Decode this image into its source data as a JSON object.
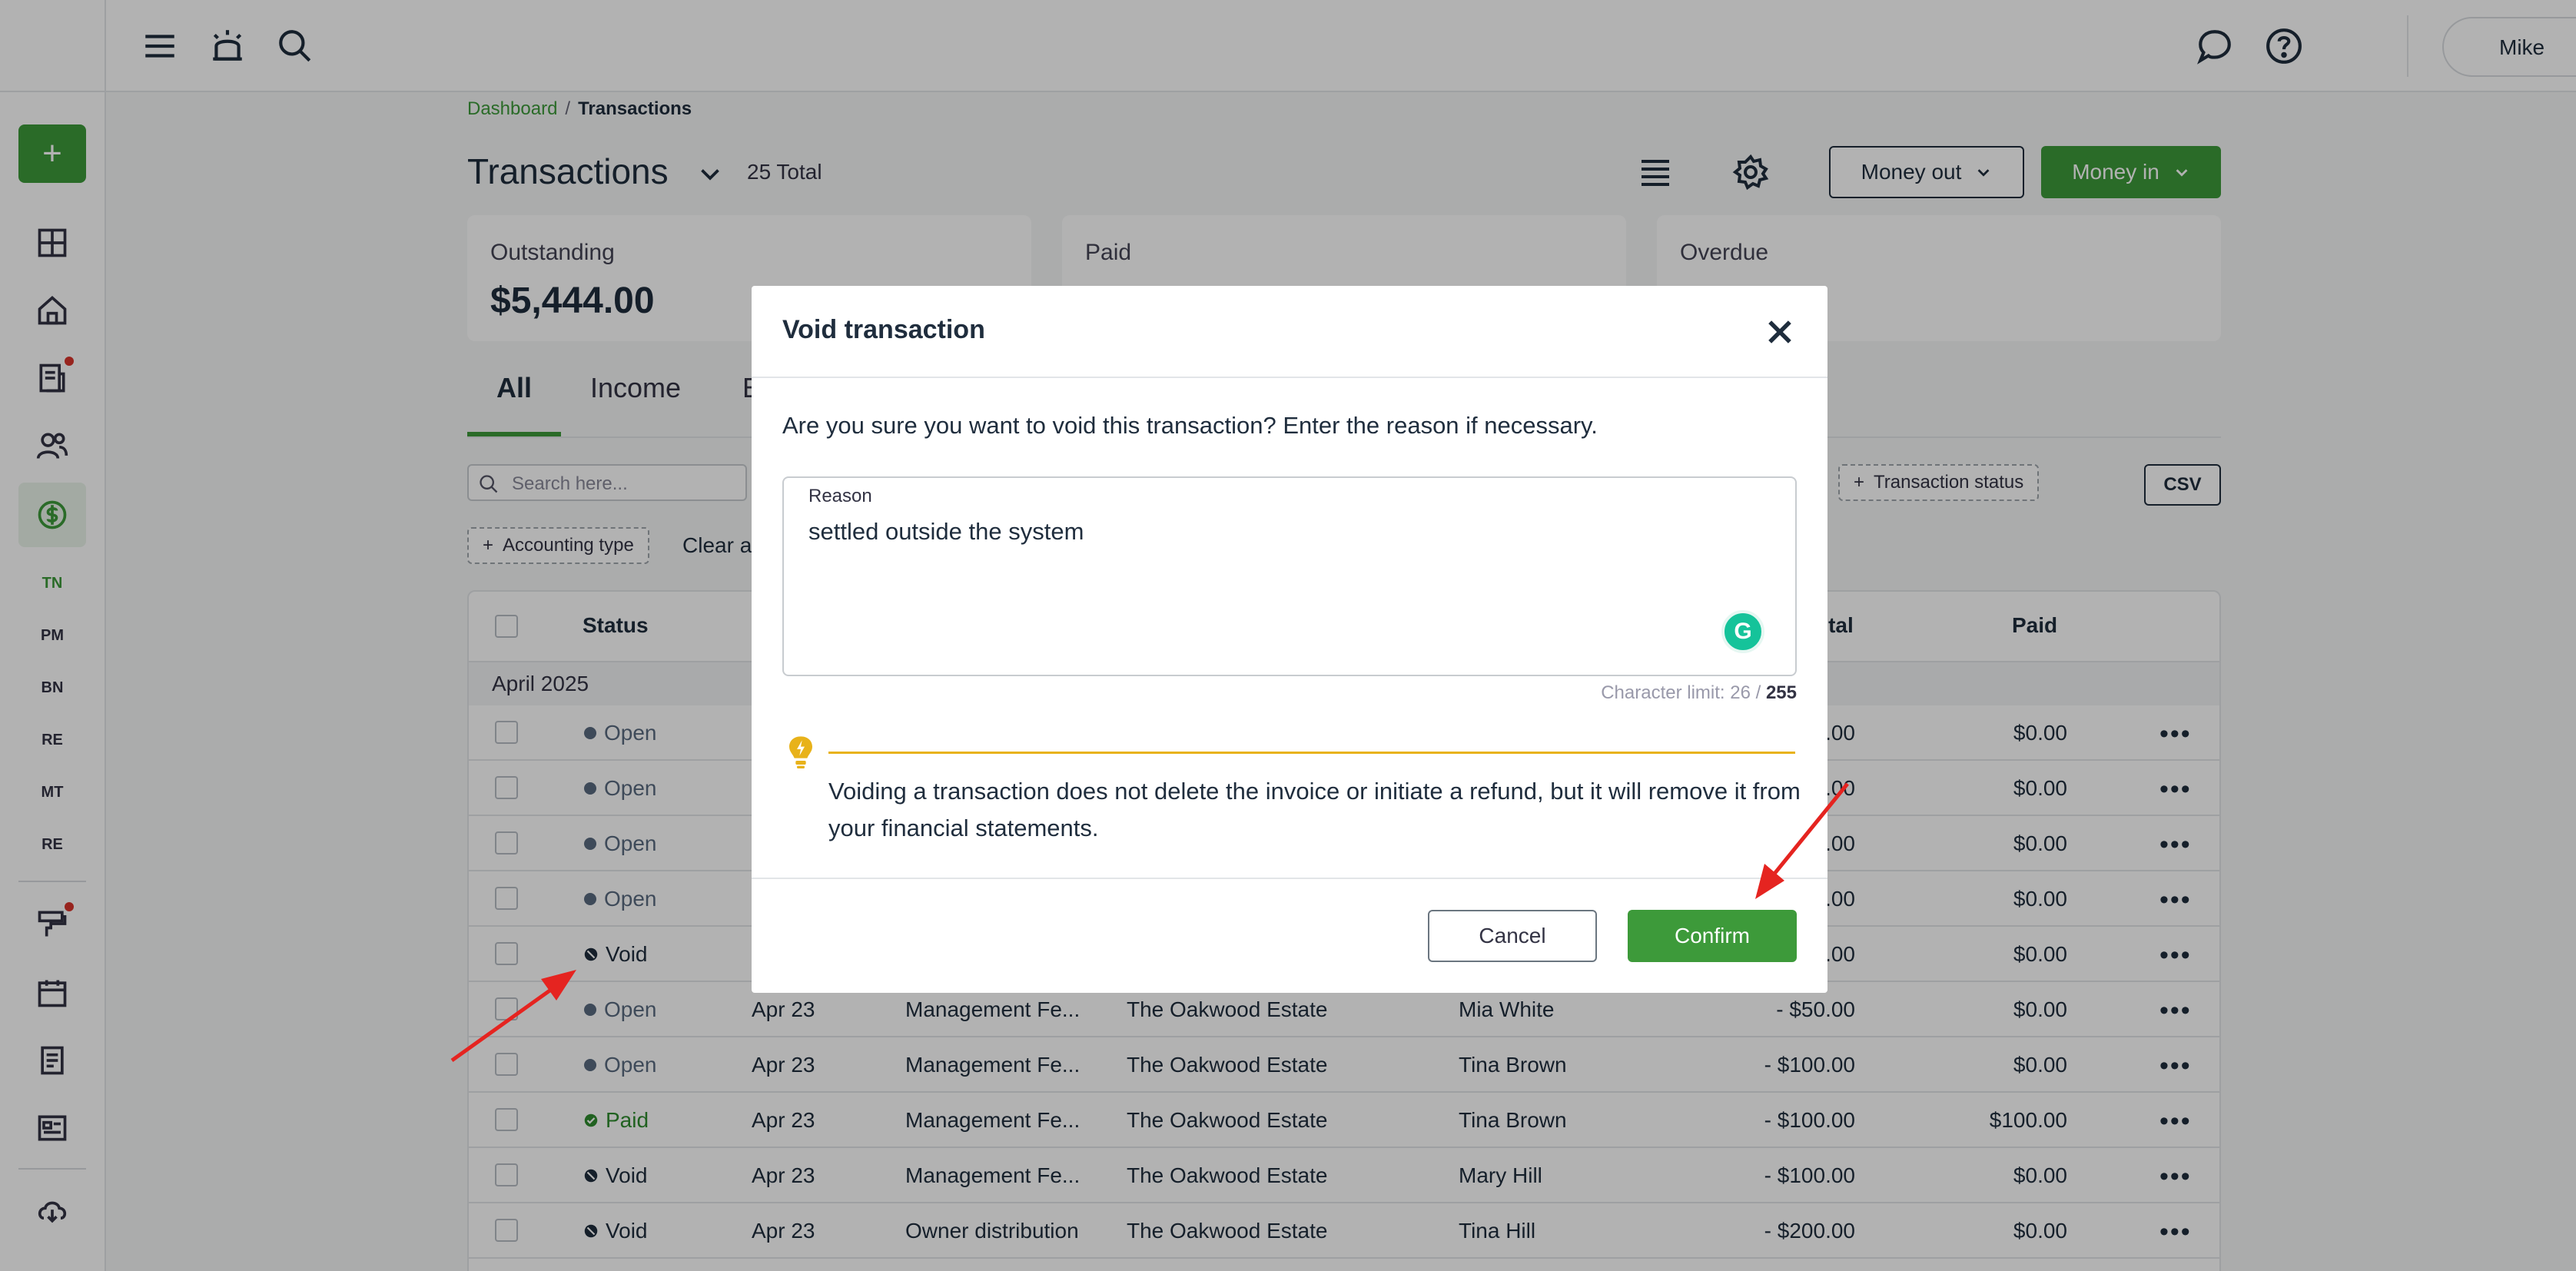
{
  "sidebar": {
    "add_label": "+",
    "abbrs": [
      "TN",
      "PM",
      "BN",
      "RE",
      "MT",
      "RE"
    ]
  },
  "topbar": {
    "user_name": "Mike"
  },
  "breadcrumb": {
    "parent": "Dashboard",
    "separator": "/",
    "current": "Transactions"
  },
  "header": {
    "title": "Transactions",
    "total": "25 Total",
    "money_out": "Money out",
    "money_in": "Money in"
  },
  "cards": [
    {
      "label": "Outstanding",
      "value": "$5,444.00"
    },
    {
      "label": "Paid",
      "value": ""
    },
    {
      "label": "Overdue",
      "value": ""
    }
  ],
  "tabs": [
    "All",
    "Income",
    "E"
  ],
  "filters": {
    "search_placeholder": "Search here...",
    "accounting_type": "Accounting type",
    "transaction_status": "Transaction status",
    "clear": "Clear a",
    "csv": "CSV"
  },
  "table": {
    "columns": {
      "status": "Status",
      "total": "otal",
      "paid": "Paid"
    },
    "group": "April 2025",
    "rows": [
      {
        "status": "Open",
        "date": "",
        "type": "",
        "property": "",
        "name": "",
        "total": ".00",
        "paid": "$0.00"
      },
      {
        "status": "Open",
        "date": "",
        "type": "",
        "property": "",
        "name": "",
        "total": ".00",
        "paid": "$0.00"
      },
      {
        "status": "Open",
        "date": "",
        "type": "",
        "property": "",
        "name": "",
        "total": ".00",
        "paid": "$0.00"
      },
      {
        "status": "Open",
        "date": "",
        "type": "",
        "property": "",
        "name": "",
        "total": ".00",
        "paid": "$0.00"
      },
      {
        "status": "Void",
        "date": "",
        "type": "",
        "property": "",
        "name": "",
        "total": ".00",
        "paid": "$0.00"
      },
      {
        "status": "Open",
        "date": "Apr 23",
        "type": "Management Fe...",
        "property": "The Oakwood Estate",
        "name": "Mia White",
        "total": "- $50.00",
        "paid": "$0.00"
      },
      {
        "status": "Open",
        "date": "Apr 23",
        "type": "Management Fe...",
        "property": "The Oakwood Estate",
        "name": "Tina Brown",
        "total": "- $100.00",
        "paid": "$0.00"
      },
      {
        "status": "Paid",
        "date": "Apr 23",
        "type": "Management Fe...",
        "property": "The Oakwood Estate",
        "name": "Tina Brown",
        "total": "- $100.00",
        "paid": "$100.00"
      },
      {
        "status": "Void",
        "date": "Apr 23",
        "type": "Management Fe...",
        "property": "The Oakwood Estate",
        "name": "Mary Hill",
        "total": "- $100.00",
        "paid": "$0.00"
      },
      {
        "status": "Void",
        "date": "Apr 23",
        "type": "Owner distribution",
        "property": "The Oakwood Estate",
        "name": "Tina Hill",
        "total": "- $200.00",
        "paid": "$0.00"
      }
    ],
    "more": "•••"
  },
  "modal": {
    "title": "Void transaction",
    "question": "Are you sure you want to void this transaction? Enter the reason if necessary.",
    "reason_label": "Reason",
    "reason_value": "settled outside the system",
    "char_limit_prefix": "Character limit: 26 /",
    "char_limit_max": "255",
    "warning": "Voiding a transaction does not delete the invoice or initiate a refund, but it will remove it from your financial statements.",
    "cancel": "Cancel",
    "confirm": "Confirm",
    "grammarly": "G"
  },
  "colors": {
    "accent": "#3d9a3a",
    "open": "#5a6b80",
    "void": "#1f2d3d",
    "paid": "#2e8b2e",
    "warning": "#e8b21a",
    "annotation": "#e52420"
  }
}
